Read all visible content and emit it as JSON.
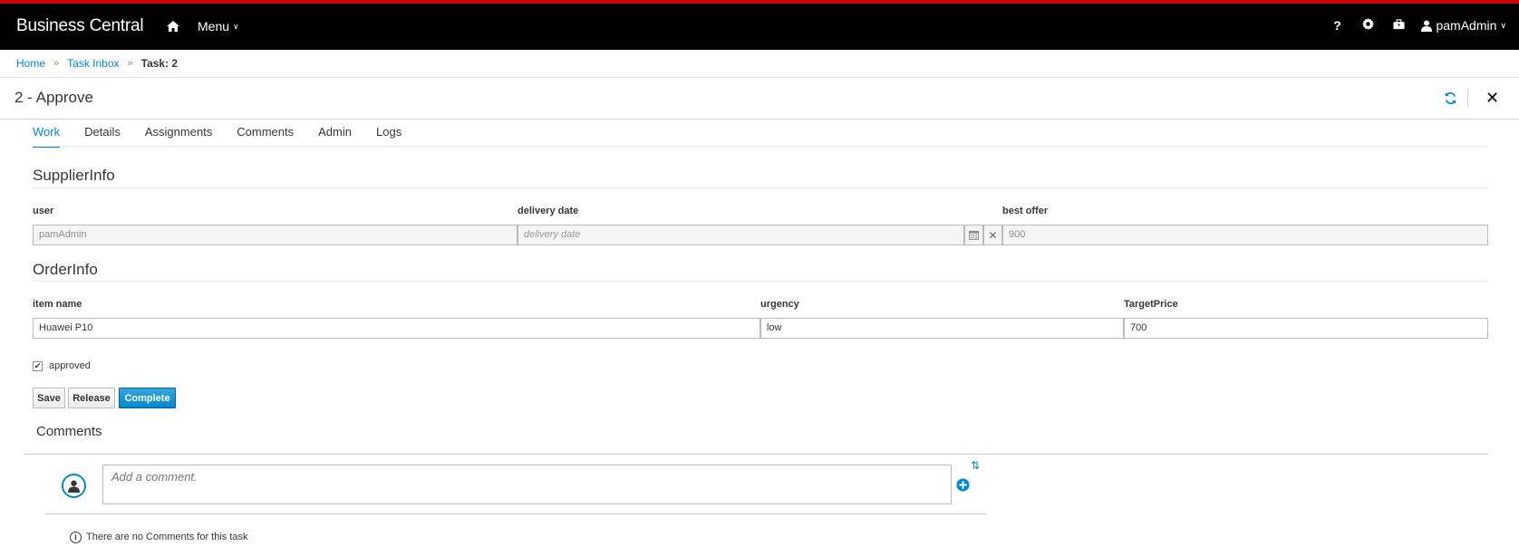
{
  "app": {
    "brand": "Business Central",
    "menu_label": "Menu",
    "help_label": "?",
    "user_label": "pamAdmin"
  },
  "breadcrumb": {
    "home": "Home",
    "task_inbox": "Task Inbox",
    "current": "Task: 2"
  },
  "page": {
    "title": "2 - Approve"
  },
  "tabs": [
    {
      "label": "Work",
      "active": true
    },
    {
      "label": "Details"
    },
    {
      "label": "Assignments"
    },
    {
      "label": "Comments"
    },
    {
      "label": "Admin"
    },
    {
      "label": "Logs"
    }
  ],
  "supplier_info": {
    "title": "SupplierInfo",
    "user_label": "user",
    "user_value": "pamAdmin",
    "delivery_label": "delivery date",
    "delivery_placeholder": "delivery date",
    "best_offer_label": "best offer",
    "best_offer_value": "900"
  },
  "order_info": {
    "title": "OrderInfo",
    "item_label": "item name",
    "item_value": "Huawei P10",
    "urgency_label": "urgency",
    "urgency_value": "low",
    "target_label": "TargetPrice",
    "target_value": "700"
  },
  "approved": {
    "label": "approved",
    "checked": true
  },
  "actions": {
    "save": "Save",
    "release": "Release",
    "complete": "Complete"
  },
  "comments": {
    "title": "Comments",
    "placeholder": "Add a comment.",
    "empty_text": "There are no Comments for this task"
  },
  "colors": {
    "accent": "#0088ce",
    "topbar": "#000000",
    "topbar_stripe": "#cc0000"
  }
}
